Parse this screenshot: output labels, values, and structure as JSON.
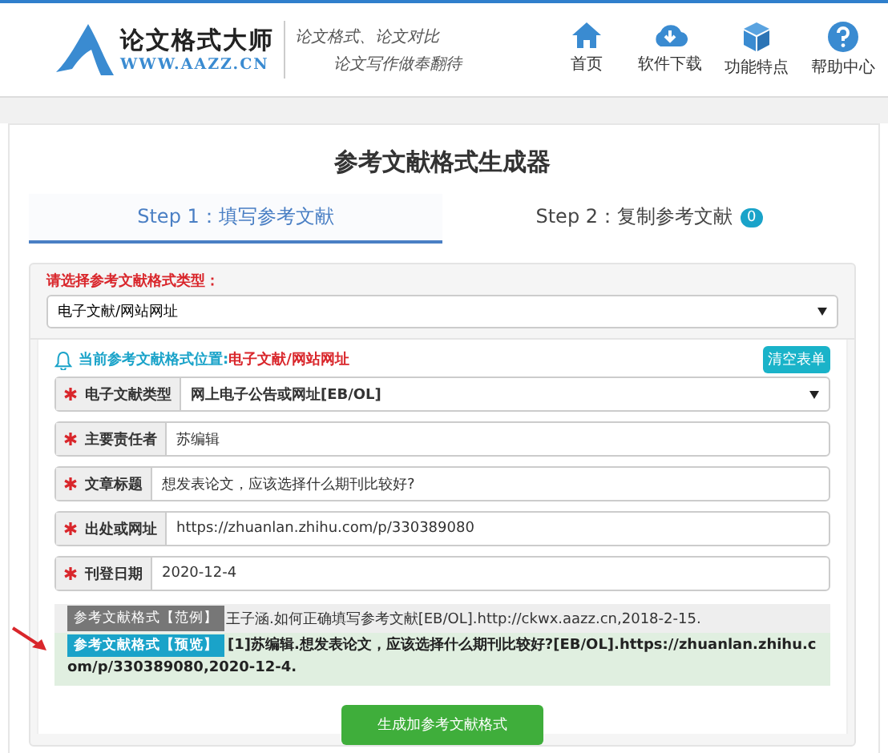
{
  "header": {
    "logo_title": "论文格式大师",
    "logo_url": "WWW.AAZZ.CN",
    "tagline": [
      "论文格式、论文对比",
      "论文写作做奉翻待"
    ],
    "nav": [
      {
        "label": "首页",
        "kind": "home"
      },
      {
        "label": "软件下载",
        "kind": "download"
      },
      {
        "label": "功能特点",
        "kind": "cube"
      },
      {
        "label": "帮助中心",
        "kind": "help"
      }
    ]
  },
  "title": "参考文献格式生成器",
  "tabs": [
    {
      "label": "Step 1：填写参考文献",
      "selected": true
    },
    {
      "label": "Step 2：复制参考文献",
      "selected": false,
      "badge": "0"
    }
  ],
  "type_select": {
    "label": "请选择参考文献格式类型：",
    "value": "电子文献/网站网址"
  },
  "location": {
    "label": "当前参考文献格式位置:",
    "value": "电子文献/网站网址"
  },
  "clear_button": "清空表单",
  "fields": [
    {
      "label": "电子文献类型",
      "value": "网上电子公告或网址[EB/OL]",
      "kind": "select",
      "required": true
    },
    {
      "label": "主要责任者",
      "value": "苏编辑",
      "kind": "input",
      "required": true
    },
    {
      "label": "文章标题",
      "value": "想发表论文，应该选择什么期刊比较好?",
      "kind": "input",
      "required": true
    },
    {
      "label": "出处或网址",
      "value": "https://zhuanlan.zhihu.com/p/330389080",
      "kind": "input",
      "required": true
    },
    {
      "label": "刊登日期",
      "value": "2020-12-4",
      "kind": "input",
      "required": true
    }
  ],
  "example": {
    "badge": "参考文献格式【范例】",
    "text": "王子涵.如何正确填写参考文献[EB/OL].http://ckwx.aazz.cn,2018-2-15."
  },
  "preview": {
    "badge": "参考文献格式【预览】",
    "text": "[1]苏编辑.想发表论文，应该选择什么期刊比较好?[EB/OL].https://zhuanlan.zhihu.com/p/330389080,2020-12-4."
  },
  "generate_button": "生成加参考文献格式"
}
